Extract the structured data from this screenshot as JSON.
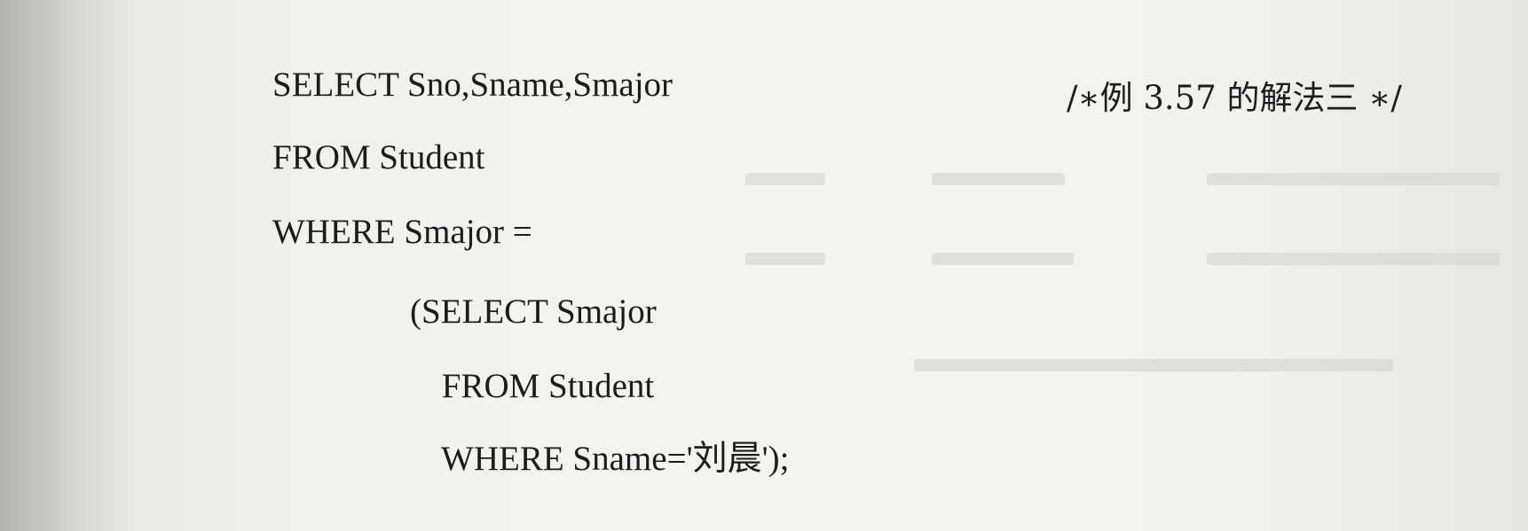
{
  "code_lines": [
    "SELECT Sno,Sname,Smajor",
    "FROM Student",
    "WHERE Smajor =",
    "(SELECT Smajor",
    " FROM Student",
    " WHERE Sname='刘晨');"
  ],
  "comment": "/∗例 3.57 的解法三 ∗/"
}
